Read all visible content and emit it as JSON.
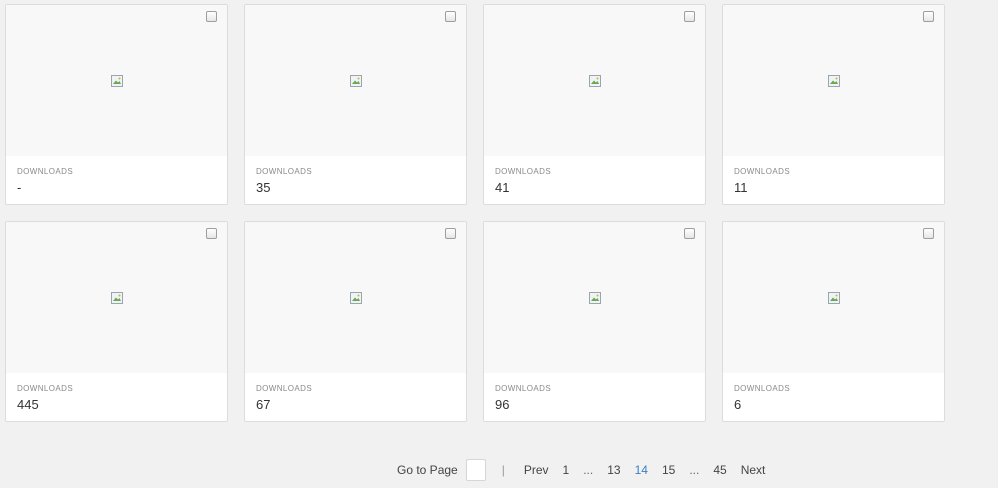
{
  "cards": [
    {
      "label": "DOWNLOADS",
      "value": "-"
    },
    {
      "label": "DOWNLOADS",
      "value": "35"
    },
    {
      "label": "DOWNLOADS",
      "value": "41"
    },
    {
      "label": "DOWNLOADS",
      "value": "11"
    },
    {
      "label": "DOWNLOADS",
      "value": "445"
    },
    {
      "label": "DOWNLOADS",
      "value": "67"
    },
    {
      "label": "DOWNLOADS",
      "value": "96"
    },
    {
      "label": "DOWNLOADS",
      "value": "6"
    }
  ],
  "pagination": {
    "goto_label": "Go to Page",
    "goto_value": "",
    "separator": "|",
    "prev": "Prev",
    "first": "1",
    "ellipsis_left": "...",
    "page_prev": "13",
    "page_current": "14",
    "page_next": "15",
    "ellipsis_right": "...",
    "last": "45",
    "next": "Next"
  },
  "colors": {
    "background": "#f1f1f1",
    "card": "#ffffff",
    "thumb": "#f8f8f8",
    "active_page": "#3b7fc4"
  },
  "icons": {
    "thumbnail": "broken-image-icon",
    "select": "checkbox"
  }
}
